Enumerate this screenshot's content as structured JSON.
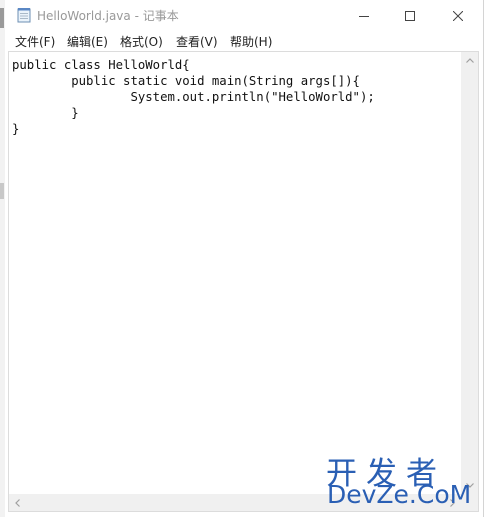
{
  "window": {
    "title": "HelloWorld.java - 记事本"
  },
  "menu": {
    "items": [
      {
        "label": "文件(F)"
      },
      {
        "label": "编辑(E)"
      },
      {
        "label": "格式(O)"
      },
      {
        "label": "查看(V)"
      },
      {
        "label": "帮助(H)"
      }
    ]
  },
  "editor": {
    "content": "public class HelloWorld{\n        public static void main(String args[]){\n                System.out.println(\"HelloWorld\");\n        }\n}"
  },
  "watermark": {
    "chinese": "开发者",
    "english": "DevZe.CoM"
  },
  "icons": {
    "app": "notepad-icon",
    "minimize": "minimize-icon",
    "maximize": "maximize-icon",
    "close": "close-icon"
  }
}
